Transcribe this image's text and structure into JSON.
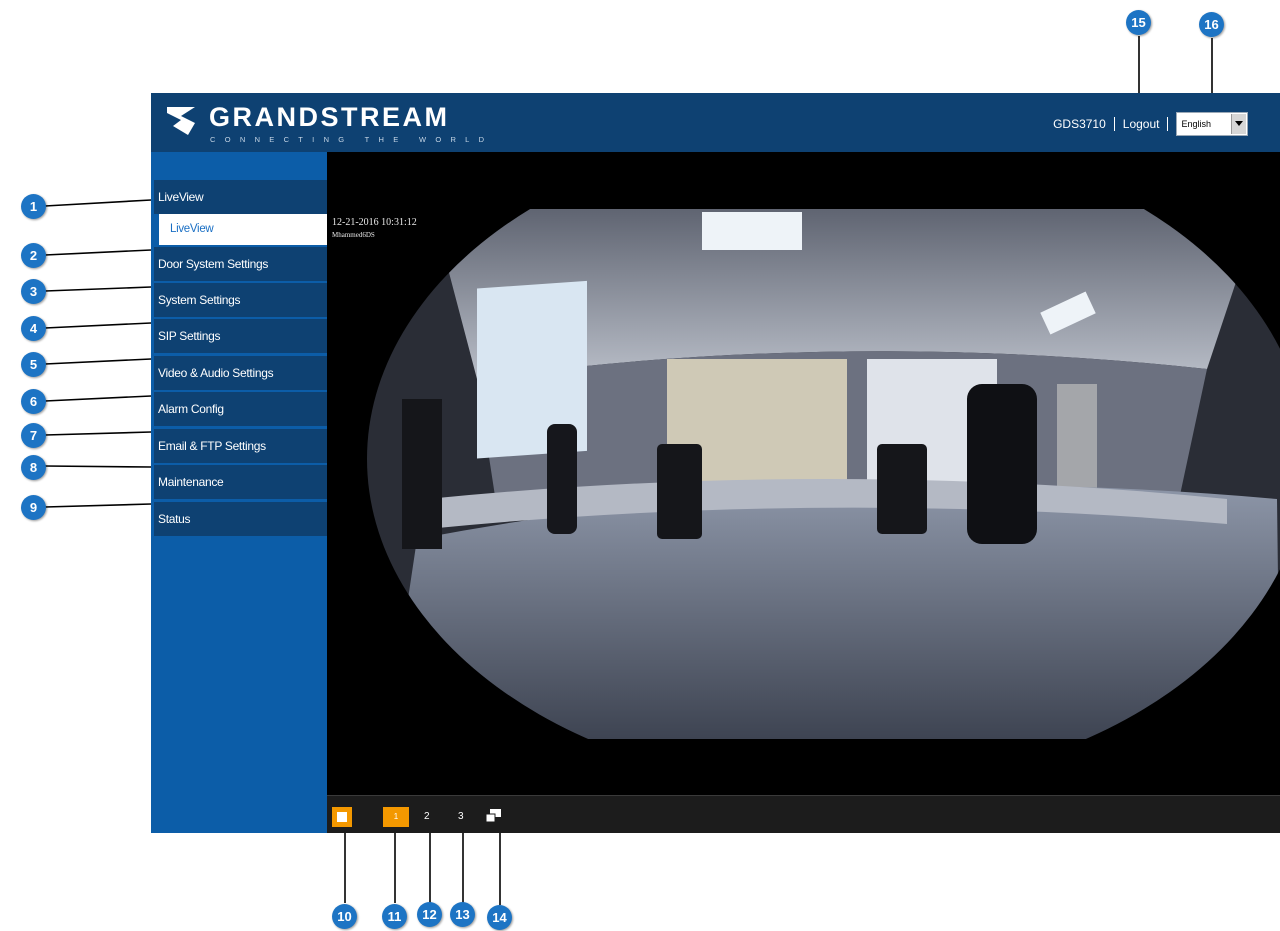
{
  "header": {
    "brand_name": "GRANDSTREAM",
    "brand_tagline": "CONNECTING THE WORLD",
    "device_name": "GDS3710",
    "logout_label": "Logout",
    "language": "English"
  },
  "sidebar": {
    "items": [
      {
        "label": "LiveView"
      },
      {
        "label": "LiveView"
      },
      {
        "label": "Door System Settings"
      },
      {
        "label": "System Settings"
      },
      {
        "label": "SIP Settings"
      },
      {
        "label": "Video & Audio Settings"
      },
      {
        "label": "Alarm Config"
      },
      {
        "label": "Email & FTP Settings"
      },
      {
        "label": "Maintenance"
      },
      {
        "label": "Status"
      }
    ]
  },
  "video": {
    "timestamp": "12-21-2016 10:31:12",
    "camera_name": "Mhammed6DS"
  },
  "controls": {
    "page1": "1",
    "page2": "2",
    "page3": "3"
  },
  "callouts": [
    "1",
    "2",
    "3",
    "4",
    "5",
    "6",
    "7",
    "8",
    "9",
    "10",
    "11",
    "12",
    "13",
    "14",
    "15",
    "16"
  ],
  "colors": {
    "header_bg": "#0e4172",
    "sidebar_bg": "#0c5da8",
    "accent_orange": "#f39800",
    "callout_blue": "#1d74c4"
  }
}
